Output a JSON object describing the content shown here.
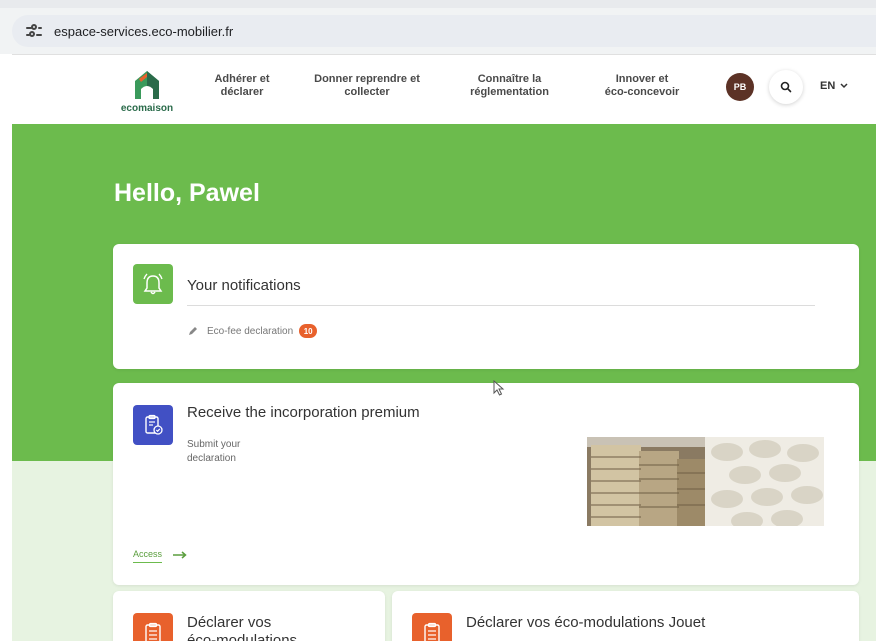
{
  "browser": {
    "url": "espace-services.eco-mobilier.fr"
  },
  "header": {
    "logo_text": "ecomaison",
    "nav": [
      {
        "line1": "Adhérer et",
        "line2": "déclarer"
      },
      {
        "line1": "Donner reprendre et",
        "line2": "collecter"
      },
      {
        "line1": "Connaître la",
        "line2": "réglementation"
      },
      {
        "line1": "Innover et",
        "line2": "éco-concevoir"
      }
    ],
    "avatar_initials": "PB",
    "search_icon": "search-icon",
    "language": "EN"
  },
  "greeting": "Hello, Pawel",
  "notifications_card": {
    "title": "Your notifications",
    "icon": "bell-icon",
    "item_label": "Eco-fee declaration",
    "item_count": "10"
  },
  "premium_card": {
    "title": "Receive the incorporation premium",
    "icon": "clipboard-check-icon",
    "subtitle_line1": "Submit your",
    "subtitle_line2": "declaration",
    "access_label": "Access"
  },
  "card_declarer_vos": {
    "title_line1": "Déclarer vos",
    "title_line2": "éco-modulations",
    "icon": "clipboard-list-icon"
  },
  "card_declarer_jouet": {
    "title": "Déclarer vos éco-modulations Jouet",
    "icon": "clipboard-list-icon"
  },
  "colors": {
    "brand_green": "#6cbb4d",
    "accent_orange": "#e8612c",
    "accent_blue": "#4150c4",
    "avatar_brown": "#5c3226"
  }
}
